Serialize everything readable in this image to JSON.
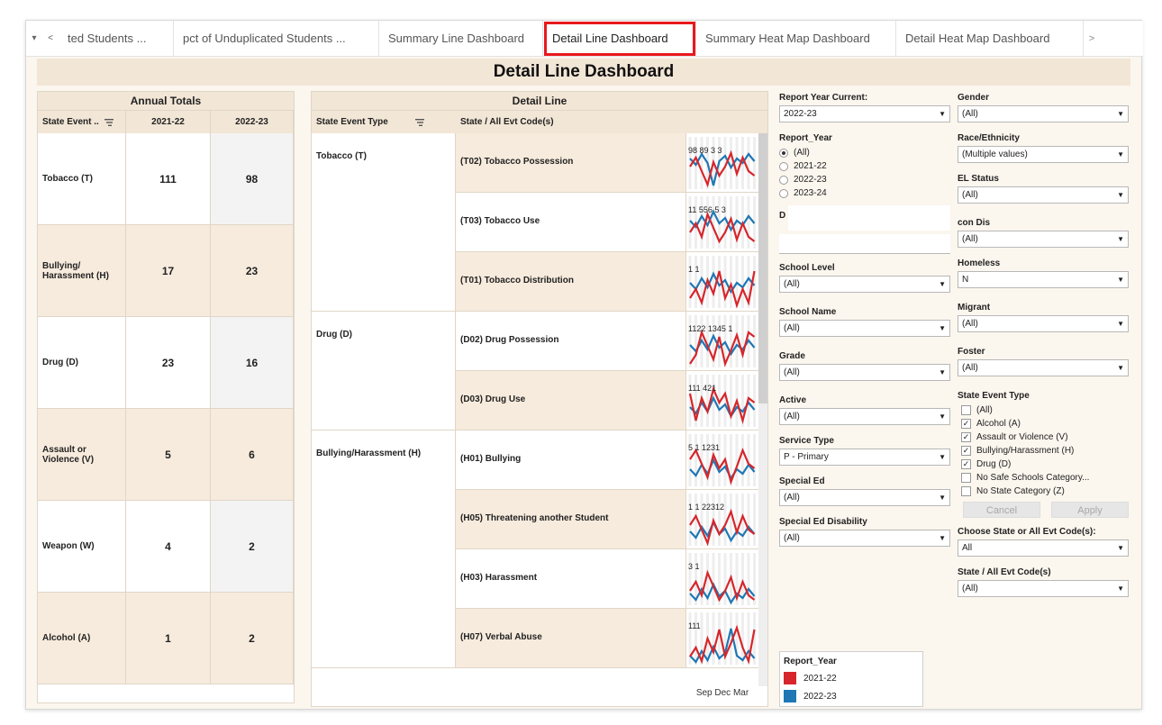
{
  "tabs": {
    "controls": {
      "menu": "▾",
      "prev": "<"
    },
    "items": [
      {
        "label": "ted Students ...",
        "active": false
      },
      {
        "label": "pct of Unduplicated Students ...",
        "active": false
      },
      {
        "label": "Summary Line Dashboard",
        "active": false
      },
      {
        "label": "Detail Line Dashboard",
        "active": true
      },
      {
        "label": "Summary Heat Map Dashboard",
        "active": false
      },
      {
        "label": "Detail Heat Map Dashboard",
        "active": false
      }
    ],
    "more": ">"
  },
  "title": "Detail Line Dashboard",
  "annual": {
    "header": "Annual Totals",
    "columns": [
      "State Event ..",
      "2021-22",
      "2022-23"
    ],
    "rows": [
      {
        "label": "Tobacco (T)",
        "y1": "111",
        "y2": "98"
      },
      {
        "label": "Bullying/ Harassment (H)",
        "y1": "17",
        "y2": "23"
      },
      {
        "label": "Drug (D)",
        "y1": "23",
        "y2": "16"
      },
      {
        "label": "Assault or Violence (V)",
        "y1": "5",
        "y2": "6"
      },
      {
        "label": "Weapon (W)",
        "y1": "4",
        "y2": "2"
      },
      {
        "label": "Alcohol (A)",
        "y1": "1",
        "y2": "2"
      }
    ]
  },
  "detail": {
    "header": "Detail Line",
    "col1": "State Event Type",
    "col2": "State / All Evt Code(s)",
    "types": [
      "Tobacco (T)",
      "Drug (D)",
      "Bullying/Harassment (H)"
    ],
    "rows": [
      {
        "label": "(T02) Tobacco Possession",
        "nums": "98 89 3 3"
      },
      {
        "label": "(T03) Tobacco Use",
        "nums": "11 556 5 3"
      },
      {
        "label": "(T01) Tobacco Distribution",
        "nums": "1 1"
      },
      {
        "label": "(D02) Drug Possession",
        "nums": "1122 1345 1"
      },
      {
        "label": "(D03) Drug Use",
        "nums": "111 421"
      },
      {
        "label": "(H01) Bullying",
        "nums": "5 1 1231"
      },
      {
        "label": "(H05) Threatening another Student",
        "nums": "1 1 22312"
      },
      {
        "label": "(H03) Harassment",
        "nums": "3 1"
      },
      {
        "label": "(H07) Verbal Abuse",
        "nums": "111"
      }
    ],
    "axis": "Sep Dec Mar"
  },
  "filters": {
    "report_year_current": {
      "label": "Report Year Current:",
      "value": "2022-23"
    },
    "report_year": {
      "label": "Report_Year",
      "options": [
        "(All)",
        "2021-22",
        "2022-23",
        "2023-24"
      ],
      "selected": "(All)"
    },
    "district": {
      "label": "D"
    },
    "school_level": {
      "label": "School Level",
      "value": "(All)"
    },
    "school_name": {
      "label": "School Name",
      "value": "(All)"
    },
    "grade": {
      "label": "Grade",
      "value": "(All)"
    },
    "active": {
      "label": "Active",
      "value": "(All)"
    },
    "service_type": {
      "label": "Service Type",
      "value": "P - Primary"
    },
    "special_ed": {
      "label": "Special Ed",
      "value": "(All)"
    },
    "special_ed_disability": {
      "label": "Special Ed Disability",
      "value": "(All)"
    },
    "gender": {
      "label": "Gender",
      "value": "(All)"
    },
    "race": {
      "label": "Race/Ethnicity",
      "value": "(Multiple values)"
    },
    "el_status": {
      "label": "EL Status",
      "value": "(All)"
    },
    "econ_dis": {
      "label": "con Dis",
      "value": "(All)"
    },
    "homeless": {
      "label": "Homeless",
      "value": "N"
    },
    "migrant": {
      "label": "Migrant",
      "value": "(All)"
    },
    "foster": {
      "label": "Foster",
      "value": "(All)"
    },
    "state_event_type": {
      "label": "State Event Type",
      "options": [
        {
          "label": "(All)",
          "checked": false
        },
        {
          "label": "Alcohol (A)",
          "checked": true
        },
        {
          "label": "Assault or Violence (V)",
          "checked": true
        },
        {
          "label": "Bullying/Harassment (H)",
          "checked": true
        },
        {
          "label": "Drug (D)",
          "checked": true
        },
        {
          "label": "No Safe Schools Category...",
          "checked": false
        },
        {
          "label": "No State Category (Z)",
          "checked": false
        }
      ],
      "cancel": "Cancel",
      "apply": "Apply"
    },
    "choose_state": {
      "label": "Choose State or All Evt Code(s):",
      "value": "All"
    },
    "state_all_evt": {
      "label": "State / All Evt Code(s)",
      "value": "(All)"
    }
  },
  "legend": {
    "title": "Report_Year",
    "items": [
      {
        "label": "2021-22",
        "color": "#d6262b"
      },
      {
        "label": "2022-23",
        "color": "#1f77b4"
      }
    ]
  },
  "icons": {
    "dropdown": "▼",
    "check": "✓",
    "sort": "sort-icon"
  }
}
